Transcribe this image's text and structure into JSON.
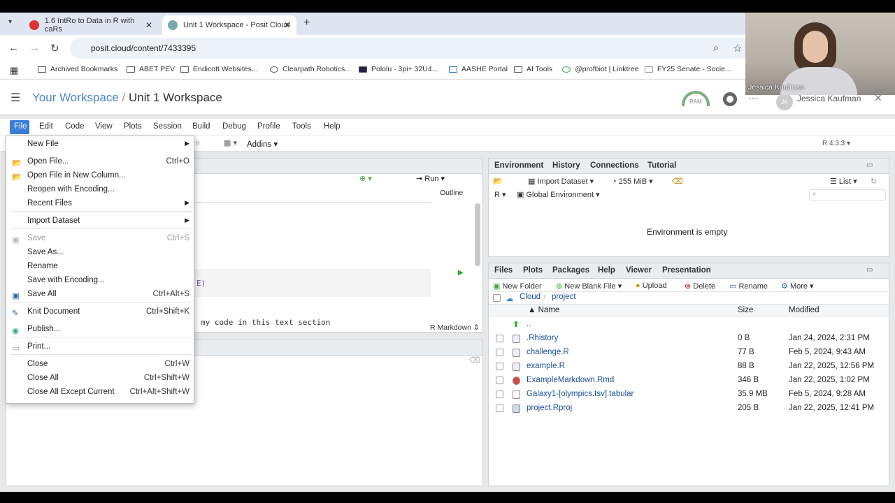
{
  "browser": {
    "tabs": [
      {
        "title": "1.6 IntRo to Data in R with caRs"
      },
      {
        "title": "Unit 1 Workspace - Posit Cloud"
      }
    ],
    "url": "posit.cloud/content/7433395",
    "bookmarks": [
      "Archived Bookmarks",
      "ABET PEV",
      "Endicott Websites...",
      "Clearpath Robotics...",
      "Pololu - 3pi+ 32U4...",
      "AASHE Portal",
      "AI Tools",
      "@profbiot | Linktree",
      "FY25 Senate - Socie..."
    ]
  },
  "workspace": {
    "crumb": "Your Workspace",
    "sep": "/",
    "project": "Unit 1 Workspace",
    "ram": "RAM",
    "user": "Jessica Kaufman",
    "avatar": "JK"
  },
  "webcam": {
    "name": "Jessica Kaufman"
  },
  "menubar": [
    "File",
    "Edit",
    "Code",
    "View",
    "Plots",
    "Session",
    "Build",
    "Debug",
    "Profile",
    "Tools",
    "Help"
  ],
  "toolbar": {
    "addins": "Addins",
    "rversion": "R 4.3.3"
  },
  "editor": {
    "run": "Run",
    "outline": "Outline",
    "mode": "R Markdown",
    "frag1": "E)",
    "frag2": "my code in this text section",
    "n": "n"
  },
  "file_menu": [
    {
      "label": "New File",
      "shortcut": "",
      "sub": true
    },
    {
      "label": "Open File...",
      "shortcut": "Ctrl+O"
    },
    {
      "label": "Open File in New Column...",
      "shortcut": ""
    },
    {
      "label": "Reopen with Encoding...",
      "shortcut": ""
    },
    {
      "label": "Recent Files",
      "shortcut": "",
      "sub": true
    },
    {
      "label": "Import Dataset",
      "shortcut": "",
      "sub": true
    },
    {
      "label": "Save",
      "shortcut": "Ctrl+S",
      "disabled": true
    },
    {
      "label": "Save As...",
      "shortcut": ""
    },
    {
      "label": "Rename",
      "shortcut": ""
    },
    {
      "label": "Save with Encoding...",
      "shortcut": ""
    },
    {
      "label": "Save All",
      "shortcut": "Ctrl+Alt+S"
    },
    {
      "label": "Knit Document",
      "shortcut": "Ctrl+Shift+K"
    },
    {
      "label": "Publish...",
      "shortcut": ""
    },
    {
      "label": "Print...",
      "shortcut": ""
    },
    {
      "label": "Close",
      "shortcut": "Ctrl+W"
    },
    {
      "label": "Close All",
      "shortcut": "Ctrl+Shift+W"
    },
    {
      "label": "Close All Except Current",
      "shortcut": "Ctrl+Alt+Shift+W"
    }
  ],
  "env": {
    "tabs": [
      "Environment",
      "History",
      "Connections",
      "Tutorial"
    ],
    "import": "Import Dataset",
    "mem": "255 MiB",
    "list": "List",
    "lang": "R",
    "scope": "Global Environment",
    "empty": "Environment is empty"
  },
  "files": {
    "tabs": [
      "Files",
      "Plots",
      "Packages",
      "Help",
      "Viewer",
      "Presentation"
    ],
    "actions": [
      "New Folder",
      "New Blank File",
      "Upload",
      "Delete",
      "Rename",
      "More"
    ],
    "path": [
      "Cloud",
      "project"
    ],
    "headers": {
      "name": "Name",
      "size": "Size",
      "modified": "Modified"
    },
    "up": "..",
    "rows": [
      {
        "name": ".Rhistory",
        "size": "0 B",
        "modified": "Jan 24, 2024, 2:31 PM"
      },
      {
        "name": "challenge.R",
        "size": "77 B",
        "modified": "Feb 5, 2024, 9:43 AM"
      },
      {
        "name": "example.R",
        "size": "88 B",
        "modified": "Jan 22, 2025, 12:56 PM"
      },
      {
        "name": "ExampleMarkdown.Rmd",
        "size": "346 B",
        "modified": "Jan 22, 2025, 1:02 PM"
      },
      {
        "name": "Galaxy1-[olympics.tsv].tabular",
        "size": "35.9 MB",
        "modified": "Feb 5, 2024, 9:28 AM"
      },
      {
        "name": "project.Rproj",
        "size": "205 B",
        "modified": "Jan 22, 2025, 12:41 PM"
      }
    ]
  }
}
